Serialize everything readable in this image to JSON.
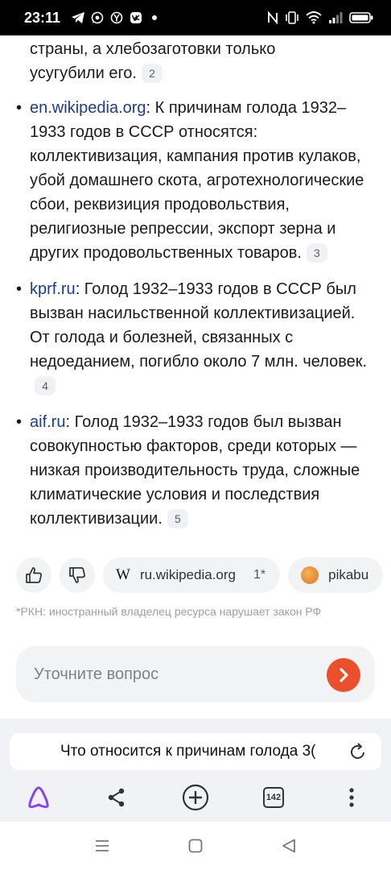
{
  "status_bar": {
    "time": "23:11",
    "left_icons": [
      "telegram-icon",
      "whatsapp-icon",
      "yandex-icon",
      "vk-icon",
      "dot-icon"
    ],
    "right_icons": [
      "nfc-icon",
      "vibrate-icon",
      "wifi-icon",
      "signal-icon",
      "battery-icon"
    ]
  },
  "answer": {
    "intro_line1": "страны, а хлебозаготовки только",
    "intro_line2": "усугубили его.",
    "intro_cite": "2",
    "items": [
      {
        "source": "en.wikipedia.org",
        "text": ": К причинам голода 1932–1933 годов в СССР относятся: коллективизация, кампания против кулаков, убой домашнего скота, агротехнологические сбои, реквизиция продовольствия, религиозные репрессии, экспорт зерна и других продовольственных товаров.",
        "cite": "3"
      },
      {
        "source": "kprf.ru",
        "text": ": Голод 1932–1933 годов в СССР был вызван насильственной коллективизацией. От голода и болезней, связанных с недоеданием, погибло около 7 млн. человек.",
        "cite": "4"
      },
      {
        "source": "aif.ru",
        "text": ": Голод 1932–1933 годов был вызван совокупностью факторов, среди которых — низкая производительность труда, сложные климатические условия и последствия коллективизации.",
        "cite": "5"
      }
    ]
  },
  "chips": {
    "like_icon": "thumbs-up-icon",
    "dislike_icon": "thumbs-down-icon",
    "source1_logo": "W",
    "source1_label": "ru.wikipedia.org",
    "source1_num": "1*",
    "source2_label": "pikabu"
  },
  "disclaimer": "*РКН: иностранный владелец ресурса нарушает закон РФ",
  "ask": {
    "placeholder": "Уточните вопрос",
    "button_icon": "chevron-right-icon",
    "button_color": "#ec4f2b"
  },
  "browser": {
    "query": "Что относится к причинам голода 3(",
    "reload_icon": "reload-icon",
    "tabs_count": "142",
    "toolbar_icons": [
      "alice-icon",
      "share-icon",
      "new-tab-icon",
      "tabs-icon",
      "more-icon"
    ],
    "accent": "#8a3ffc"
  },
  "nav": {
    "icons": [
      "menu-icon",
      "home-icon",
      "back-icon"
    ]
  }
}
